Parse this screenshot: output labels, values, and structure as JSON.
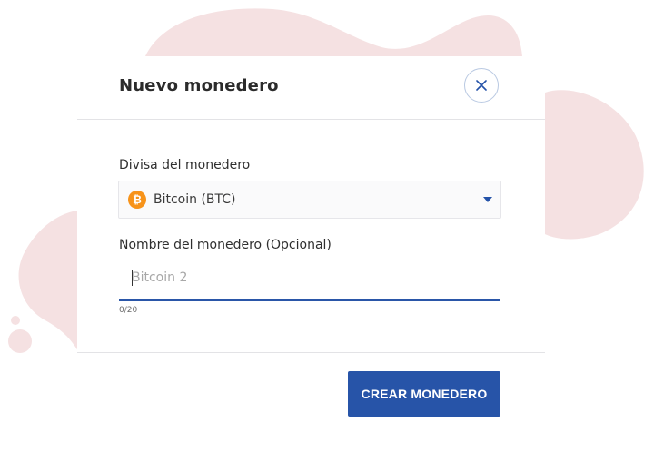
{
  "dialog": {
    "title": "Nuevo monedero",
    "close_icon": "close-icon",
    "currency_label": "Divisa del monedero",
    "currency": {
      "value": "Bitcoin (BTC)",
      "icon": "bitcoin-icon",
      "icon_symbol": "₿"
    },
    "name_label": "Nombre del monedero (Opcional)",
    "name_input": {
      "value": "",
      "placeholder": "Bitcoin 2"
    },
    "char_counter": "0/20",
    "create_button": "CREAR MONEDERO"
  },
  "colors": {
    "accent": "#2754a8",
    "blob": "#f5e1e2",
    "bitcoin": "#f7931a"
  }
}
